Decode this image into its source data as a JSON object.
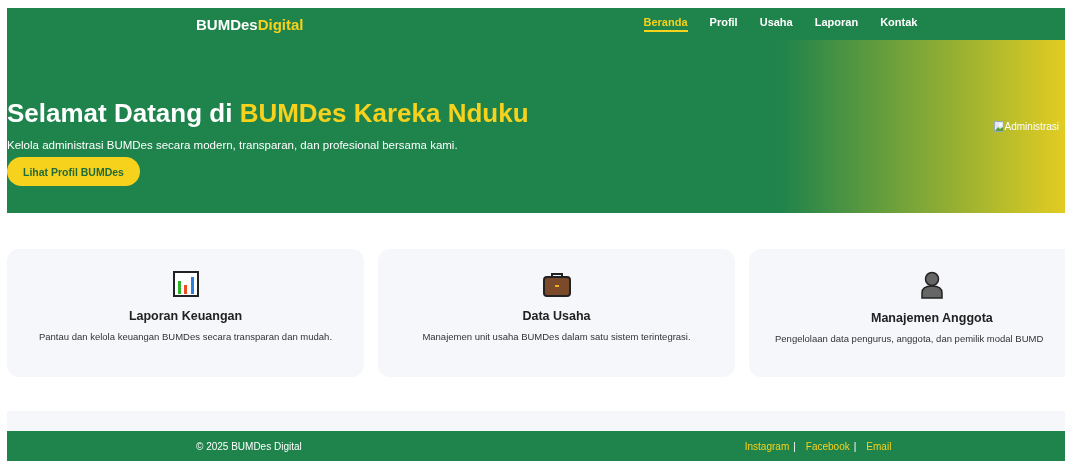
{
  "header": {
    "brand_main": "BUMDes",
    "brand_accent": "Digital",
    "nav": [
      {
        "label": "Beranda",
        "selected": true
      },
      {
        "label": "Profil",
        "selected": false
      },
      {
        "label": "Usaha",
        "selected": false
      },
      {
        "label": "Laporan",
        "selected": false
      },
      {
        "label": "Kontak",
        "selected": false
      }
    ]
  },
  "hero": {
    "title_lead": "Selamat Datang di",
    "title_highlight": "BUMDes Kareka Nduku",
    "subtitle": "Kelola administrasi BUMDes secara modern, transparan, dan profesional bersama kami.",
    "button": "Lihat Profil BUMDes",
    "image_alt": "Administrasi"
  },
  "features": [
    {
      "title": "Laporan Keuangan",
      "description": "Pantau dan kelola keuangan BUMDes secara transparan dan mudah."
    },
    {
      "title": "Data Usaha",
      "description": "Manajemen unit usaha BUMDes dalam satu sistem terintegrasi."
    },
    {
      "title": "Manajemen Anggota",
      "description": "Pengelolaan data pengurus, anggota, dan pemilik modal BUMD"
    }
  ],
  "footer": {
    "copyright": "© 2025 BUMDes Digital",
    "links": [
      "Instagram",
      "Facebook",
      "Email"
    ],
    "separators": [
      "|",
      "|"
    ]
  }
}
